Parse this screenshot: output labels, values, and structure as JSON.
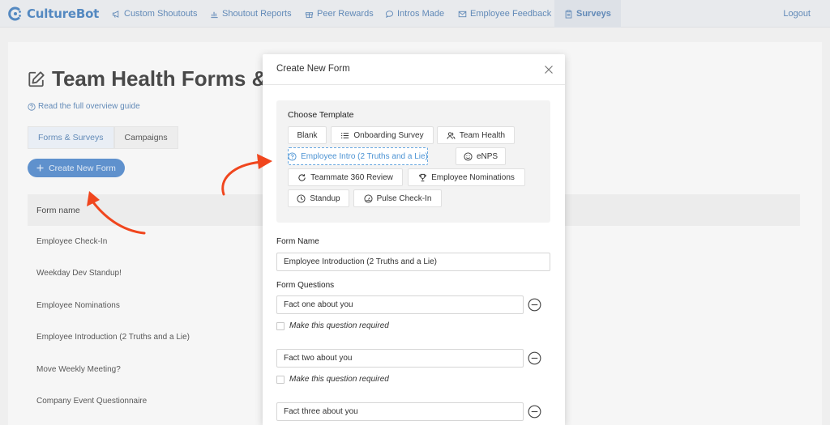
{
  "app": {
    "name": "CultureBot"
  },
  "nav": {
    "items": [
      {
        "label": "Custom Shoutouts"
      },
      {
        "label": "Shoutout Reports"
      },
      {
        "label": "Peer Rewards"
      },
      {
        "label": "Intros Made"
      },
      {
        "label": "Employee Feedback"
      },
      {
        "label": "Surveys"
      }
    ],
    "logout": "Logout",
    "active": "Surveys"
  },
  "page": {
    "title": "Team Health Forms &",
    "guide_link": "Read the full overview guide",
    "tabs": [
      {
        "label": "Forms & Surveys"
      },
      {
        "label": "Campaigns"
      }
    ],
    "create_button": "Create New Form",
    "table_header": "Form name",
    "forms": [
      "Employee Check-In",
      "Weekday Dev Standup!",
      "Employee Nominations",
      "Employee Introduction (2 Truths and a Lie)",
      "Move Weekly Meeting?",
      "Company Event Questionnaire"
    ]
  },
  "modal": {
    "title": "Create New Form",
    "choose_template_label": "Choose Template",
    "templates": [
      {
        "label": "Blank",
        "icon": "none"
      },
      {
        "label": "Onboarding Survey",
        "icon": "list-icon"
      },
      {
        "label": "Team Health",
        "icon": "people-icon"
      },
      {
        "label": "Employee Intro (2 Truths and a Lie)",
        "icon": "question-circle-icon"
      },
      {
        "label": "eNPS",
        "icon": "smile-icon"
      },
      {
        "label": "Teammate 360 Review",
        "icon": "refresh-icon"
      },
      {
        "label": "Employee Nominations",
        "icon": "trophy-icon"
      },
      {
        "label": "Standup",
        "icon": "clock-icon"
      },
      {
        "label": "Pulse Check-In",
        "icon": "gauge-icon"
      }
    ],
    "selected_template": "Employee Intro (2 Truths and a Lie)",
    "form_name_label": "Form Name",
    "form_name_value": "Employee Introduction (2 Truths and a Lie)",
    "questions_label": "Form Questions",
    "questions": [
      {
        "value": "Fact one about you",
        "required_label": "Make this question required",
        "required": false
      },
      {
        "value": "Fact two about you",
        "required_label": "Make this question required",
        "required": false
      },
      {
        "value": "Fact three about you"
      }
    ]
  },
  "colors": {
    "brand": "#2f6fb4",
    "primary_button": "#3c79c3",
    "selected_template": "#4c93d3",
    "annotation_arrow": "#f0461e"
  }
}
